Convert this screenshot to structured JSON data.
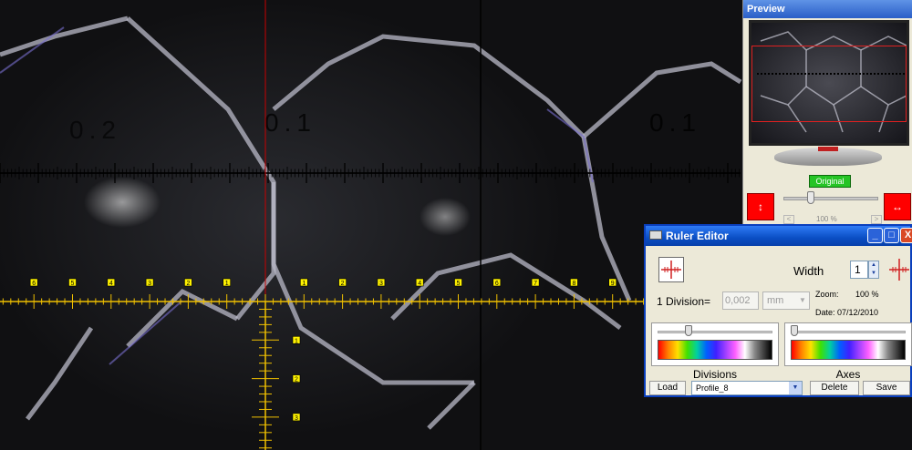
{
  "scope": {
    "scale_labels": [
      "0.2",
      "0.1",
      "0.1"
    ],
    "ruler_labels_left": [
      "6",
      "5",
      "4",
      "3",
      "2",
      "1"
    ],
    "ruler_labels_right": [
      "1",
      "2",
      "3",
      "4",
      "5",
      "6",
      "7",
      "8",
      "9"
    ],
    "ruler_labels_vertical": [
      "1",
      "2",
      "3"
    ],
    "colors": {
      "ruler": "#f0c000",
      "crosshair": "#c80000",
      "scale": "#000000"
    }
  },
  "preview": {
    "title": "Preview",
    "original_button": "Original",
    "zoom_readout": "100 %",
    "zoom_minus": "<",
    "zoom_plus": ">"
  },
  "editor": {
    "title": "Ruler Editor",
    "window_buttons": {
      "minimize": "_",
      "maximize": "□",
      "close": "X"
    },
    "width_label": "Width",
    "width_value": "1",
    "division_label": "1 Division=",
    "division_value": "0,002",
    "unit_value": "mm",
    "zoom_label": "Zoom:",
    "zoom_value": "100 %",
    "date_text": "Date: 07/12/2010",
    "divisions_label": "Divisions",
    "axes_label": "Axes",
    "load_button": "Load",
    "profile_value": "Profile_8",
    "delete_button": "Delete",
    "save_button": "Save"
  }
}
